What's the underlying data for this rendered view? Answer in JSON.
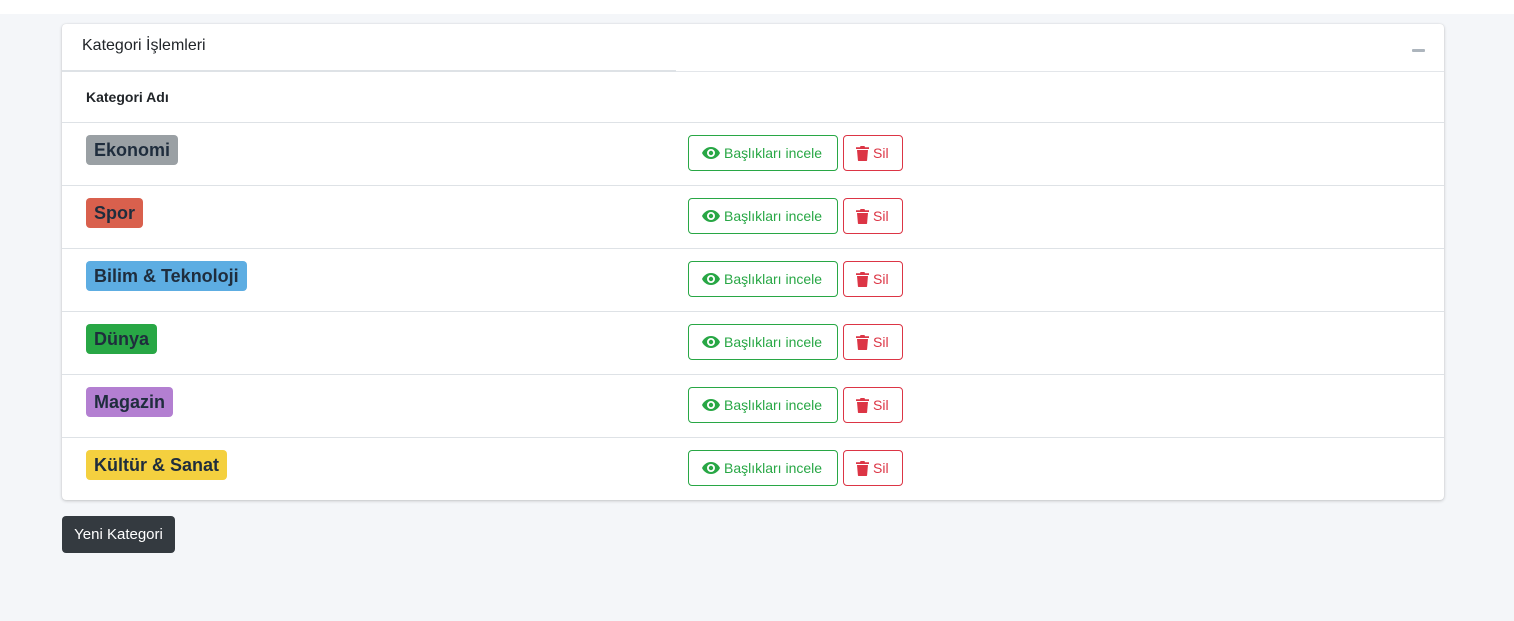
{
  "card": {
    "title": "Kategori İşlemleri",
    "collapse_icon": "minus-icon"
  },
  "table": {
    "header": "Kategori Adı",
    "rows": [
      {
        "name": "Ekonomi",
        "color": "#9aa0a4",
        "view_label": "Başlıkları incele",
        "delete_label": "Sil"
      },
      {
        "name": "Spor",
        "color": "#d9604d",
        "view_label": "Başlıkları incele",
        "delete_label": "Sil"
      },
      {
        "name": "Bilim & Teknoloji",
        "color": "#5dade2",
        "view_label": "Başlıkları incele",
        "delete_label": "Sil"
      },
      {
        "name": "Dünya",
        "color": "#28a745",
        "view_label": "Başlıkları incele",
        "delete_label": "Sil"
      },
      {
        "name": "Magazin",
        "color": "#b37fd1",
        "view_label": "Başlıkları incele",
        "delete_label": "Sil"
      },
      {
        "name": "Kültür & Sanat",
        "color": "#f4d03f",
        "view_label": "Başlıkları incele",
        "delete_label": "Sil"
      }
    ]
  },
  "icons": {
    "view": "eye-icon",
    "delete": "trash-icon"
  },
  "new_category_label": "Yeni Kategori",
  "colors": {
    "view_button": "#28a745",
    "delete_button": "#dc3545",
    "new_button": "#343a40"
  }
}
